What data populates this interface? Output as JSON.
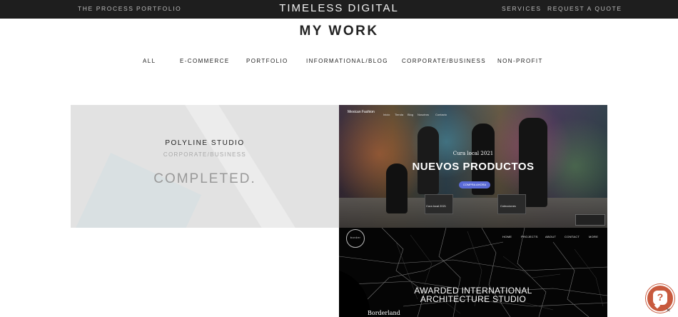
{
  "header": {
    "nav_left": [
      "THE PROCESS",
      "PORTFOLIO"
    ],
    "brand": "TIMELESS DIGITAL",
    "nav_right": [
      "SERVICES",
      "REQUEST A QUOTE"
    ]
  },
  "page": {
    "title": "MY WORK"
  },
  "filters": [
    "ALL",
    "E-COMMERCE",
    "PORTFOLIO",
    "INFORMATIONAL/BLOG",
    "CORPORATE/BUSINESS",
    "NON-PROFIT"
  ],
  "projects": [
    {
      "name": "POLYLINE STUDIO",
      "category": "CORPORATE/BUSINESS",
      "status": "COMPLETED."
    },
    {
      "preview": {
        "logo": "Mexican Fashion",
        "nav": [
          "Inicio",
          "Tienda",
          "Blog",
          "Nosotros",
          "Contacto"
        ],
        "kicker": "Cura local 2021",
        "headline": "NUEVOS PRODUCTOS",
        "cta": "COMPRA AHORA",
        "cards": [
          "Cura local 2021",
          "Colecciones"
        ]
      }
    },
    {
      "preview": {
        "logo": "border",
        "nav": [
          "HOME",
          "PROJECTS",
          "ABOUT",
          "CONTACT",
          "MORE"
        ],
        "headline_line1": "AWARDED INTERNATIONAL",
        "headline_line2": "ARCHITECTURE STUDIO",
        "brand": "Borderland"
      }
    }
  ],
  "chat": {
    "icon": "question-icon",
    "glyph": "?",
    "close_glyph": "✕",
    "accent": "#c85a3e"
  }
}
